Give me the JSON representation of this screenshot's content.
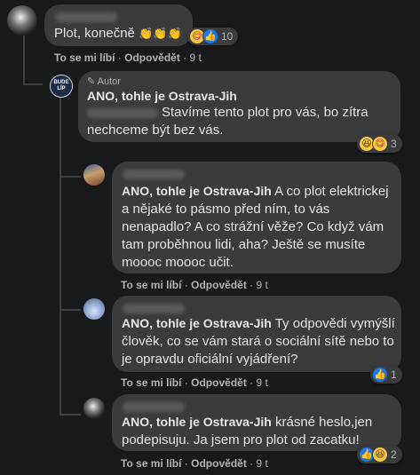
{
  "comments": [
    {
      "text": "Plot, konečně",
      "emoji": "👏👏👏",
      "reaction_count": "10",
      "actions": {
        "like": "To se mi líbí",
        "reply": "Odpovědět",
        "time": "9 t"
      }
    },
    {
      "badge": "Autor",
      "author": "ANO, tohle je Ostrava-Jih",
      "text": "Stavíme tento plot pro vás, bo zítra nechceme být bez vás.",
      "reaction_count": "3",
      "avatar_text": "BUDE LÍP"
    },
    {
      "author": "ANO, tohle je Ostrava-Jih",
      "text": " A co plot elektrickej a nějaké to pásmo před ním, to vás nenapadlo? A co strážní věže? Co když vám tam proběhnou lidi, aha? Ještě se musíte moooc moooc učit.",
      "actions": {
        "like": "To se mi líbí",
        "reply": "Odpovědět",
        "time": "9 t"
      }
    },
    {
      "author": "ANO, tohle je Ostrava-Jih",
      "text": " Ty odpovědi vymýšlí člověk, co se vám stará o sociální sítě nebo to je opravdu oficiální vyjádření?",
      "reaction_count": "1",
      "actions": {
        "like": "To se mi líbí",
        "reply": "Odpovědět",
        "time": "9 t"
      }
    },
    {
      "author": "ANO, tohle je Ostrava-Jih",
      "text": " krásné heslo,jen podepisuju. Ja jsem pro plot od zacatku!",
      "reaction_count": "2",
      "actions": {
        "like": "To se mi líbí",
        "reply": "Odpovědět",
        "time": "9 t"
      }
    }
  ],
  "colors": {
    "background": "#18191a",
    "bubble": "#3a3b3c",
    "text": "#e4e6eb",
    "muted": "#b0b3b8",
    "like_blue": "#1877f2"
  }
}
